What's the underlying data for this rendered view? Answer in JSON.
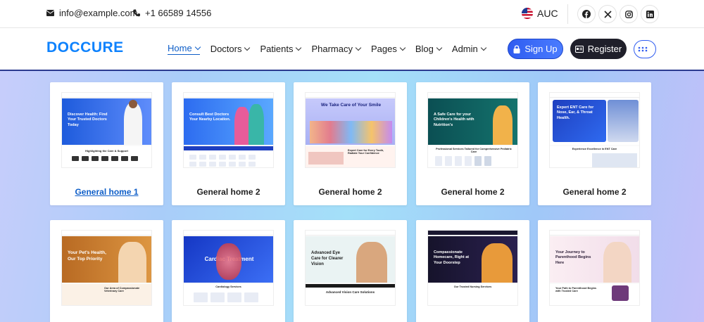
{
  "topbar": {
    "email": "info@example.com",
    "phone": "+1 66589 14556",
    "language": "AUC",
    "social": [
      "facebook-icon",
      "x-icon",
      "instagram-icon",
      "linkedin-icon"
    ]
  },
  "header": {
    "logo_part1": "DOC",
    "logo_part2": "CURE",
    "nav": [
      "Home",
      "Doctors",
      "Patients",
      "Pharmacy",
      "Pages",
      "Blog",
      "Admin"
    ],
    "signup_label": "Sign Up",
    "register_label": "Register"
  },
  "cards": [
    {
      "label": "General home 1",
      "hero_text": "Discover Health: Find Your Trusted Doctors Today",
      "hero_color": "#1e5bdc",
      "strip_text": "Highlighting the Care & Support"
    },
    {
      "label": "General home 2",
      "hero_text": "Consult Best Doctors Your Nearby Location.",
      "hero_color": "#2d6cf0",
      "strip_text": ""
    },
    {
      "label": "General home 2",
      "hero_text": "We Take Care of Your Smile",
      "hero_color": "#b3b8f5",
      "strip_text": "Expert Care for Every Tooth, Radiate Your Confidence"
    },
    {
      "label": "General home 2",
      "hero_text": "A Safe Care for your Children's Health with Nutrition's",
      "hero_color": "#0e5a5c",
      "strip_text": "Professional Services Tailored for Comprehensive Pediatric Care"
    },
    {
      "label": "General home 2",
      "hero_text": "Expert ENT Care for Nose, Ear, & Throat Health.",
      "hero_color": "#1e3fbf",
      "strip_text": "Experience Excellence in ENT Care"
    }
  ],
  "cards_row2": [
    {
      "hero_text": "Your Pet's Health, Our Top Priority",
      "hero_color": "#c87a2a",
      "strip_text": "Our Area of Compassionate Veterinary Care"
    },
    {
      "hero_text": "Cardiac Treatment",
      "hero_color": "#2048d8",
      "strip_text": "Cardiology Services"
    },
    {
      "hero_text": "Advanced Eye Care for Clearer Vision",
      "hero_color": "#e9f2f4",
      "strip_text": "Advanced Vision Care Solutions"
    },
    {
      "hero_text": "Compassionate Homecare, Right at Your Doorstep",
      "hero_color": "#1a1730",
      "strip_text": "Our Trusted Nursing Services"
    },
    {
      "hero_text": "Your Journey to Parenthood Begins Here",
      "hero_color": "#f6e6ee",
      "strip_text": "Your Path to Parenthood Begins with Trusted Care"
    }
  ],
  "colors": {
    "accent": "#0e82fd",
    "brand_dark": "#1f1f2a",
    "nav_active": "#0e5ec8"
  }
}
